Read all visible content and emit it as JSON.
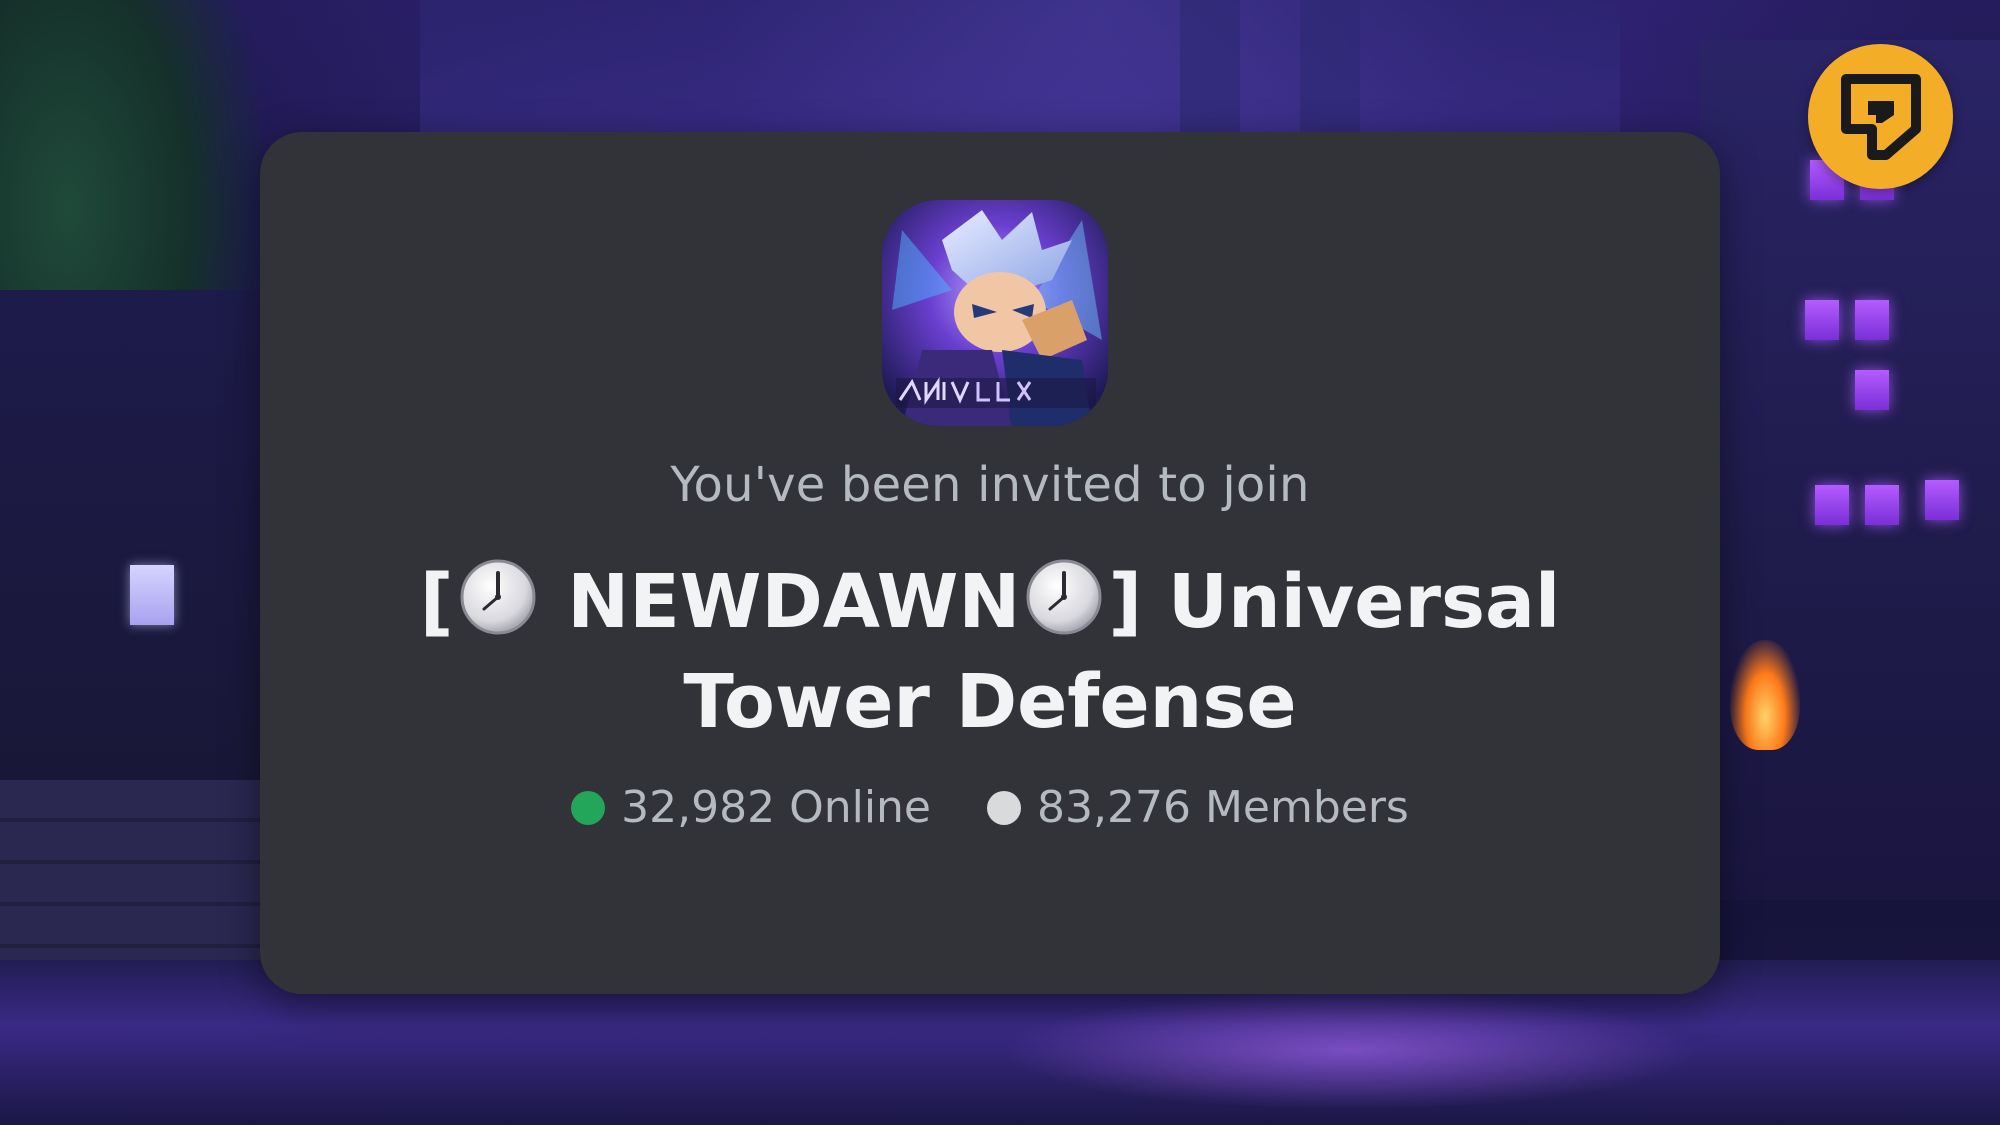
{
  "invite": {
    "subtitle": "You've been invited to join",
    "name_prefix": "[",
    "name_middle": " NEWDAWN",
    "name_suffix": "] Universal Tower Defense",
    "server_icon": "server-icon-universal-tower-defense-art",
    "clock_icon": "clock-emoji-icon"
  },
  "stats": {
    "online": "32,982 Online",
    "members": "83,276 Members",
    "online_color": "#23a55a",
    "members_color": "#d9dadc"
  },
  "logo": {
    "icon": "pocket-tactics-logo-icon",
    "color": "#f4ad27"
  },
  "colors": {
    "card_bg": "#313338",
    "text_primary": "#f2f3f5",
    "text_secondary": "#b5bac1"
  }
}
